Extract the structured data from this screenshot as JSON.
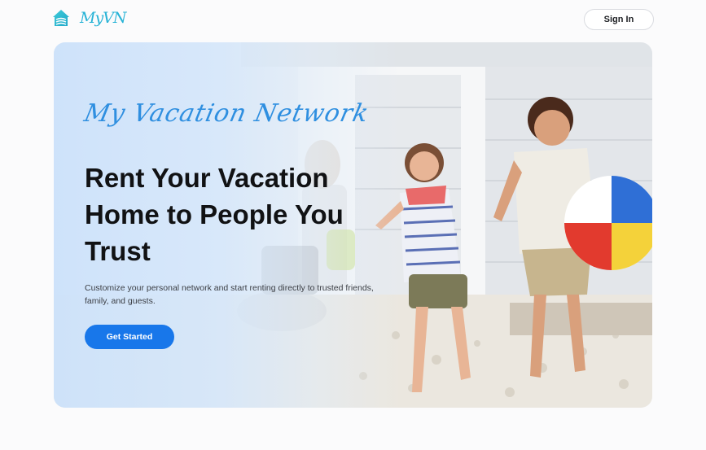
{
  "header": {
    "logo_text": "MyVN",
    "logo_icon": "house-icon",
    "signin_label": "Sign In"
  },
  "hero": {
    "script_title": "My Vacation Network",
    "headline": "Rent Your Vacation Home to People You Trust",
    "subtext": "Customize your personal network and start renting directly to trusted friends, family, and guests.",
    "cta_label": "Get Started",
    "image_description": "kids-running-on-beach-path-image",
    "colors": {
      "accent": "#1877ea",
      "script": "#2f8fe0",
      "logo": "#27b3d6"
    }
  }
}
